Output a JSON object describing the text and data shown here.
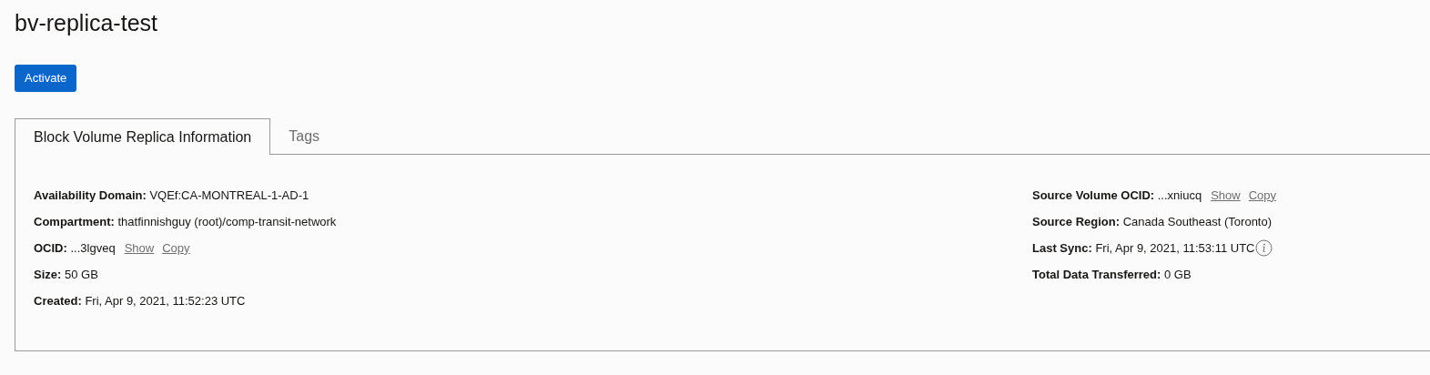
{
  "title": "bv-replica-test",
  "buttons": [
    {
      "label": "Activate"
    }
  ],
  "tabs": [
    {
      "label": "Block Volume Replica Information",
      "selected": true
    },
    {
      "label": "Tags",
      "selected": false
    }
  ],
  "details_left": [
    {
      "label": "Availability Domain:",
      "value": "VQEf:CA-MONTREAL-1-AD-1"
    },
    {
      "label": "Compartment:",
      "value": "thatfinnishguy (root)/comp-transit-network"
    },
    {
      "label": "OCID:",
      "value": "...3lgveq",
      "links": [
        "Show",
        "Copy"
      ]
    },
    {
      "label": "Size:",
      "value": "50 GB"
    },
    {
      "label": "Created:",
      "value": "Fri, Apr 9, 2021, 11:52:23 UTC"
    }
  ],
  "details_right": [
    {
      "label": "Source Volume OCID:",
      "value": "...xniucq",
      "links": [
        "Show",
        "Copy"
      ]
    },
    {
      "label": "Source Region:",
      "value": "Canada Southeast (Toronto)"
    },
    {
      "label": "Last Sync:",
      "value": "Fri, Apr 9, 2021, 11:53:11 UTC",
      "info": true
    },
    {
      "label": "Total Data Transferred:",
      "value": "0 GB"
    }
  ]
}
